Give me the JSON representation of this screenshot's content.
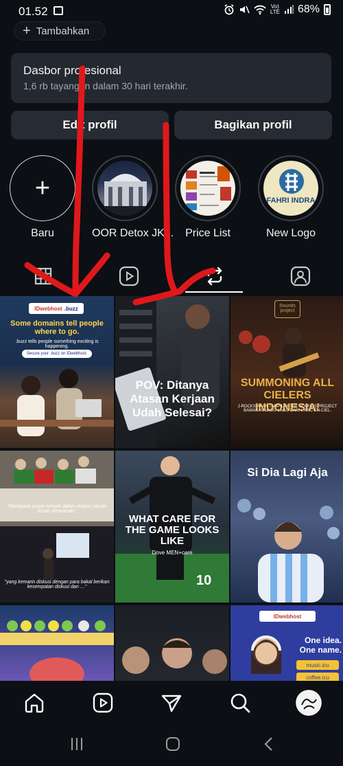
{
  "status": {
    "time": "01.52",
    "volte_top": "Vo)",
    "volte_bottom": "LTE",
    "battery": "68%"
  },
  "add_button": {
    "label": "Tambahkan"
  },
  "dashboard": {
    "title": "Dasbor profesional",
    "subtitle": "1,6 rb tayangan dalam 30 hari terakhir."
  },
  "buttons": {
    "edit": "Edit profil",
    "share": "Bagikan profil"
  },
  "highlights": [
    {
      "label": "Baru"
    },
    {
      "label": "OOR Detox JK..."
    },
    {
      "label": "Price List"
    },
    {
      "label": "New Logo",
      "art_text": "FAHRI INDRA"
    }
  ],
  "posts": [
    {
      "brand": "IDwebhost",
      "brand2": ".buzz",
      "headline": "Some domains tell people where to go.",
      "sub": ".buzz tells people something exciting is happening.",
      "cta": "Secure your .buzz on IDwebhost."
    },
    {
      "caption": "POV: Ditanya Atasan Kerjaan Udah Selesai?"
    },
    {
      "caption": "SUMMONING ALL CIELERS INDONESIA!",
      "sub": "J-ROCKS AKAN TAMPIL DI THE SOUNDS PROJECT BAWAKAN LAGU-LAGU DARI L'ARC-EN-CIEL.",
      "logo": "Sounds project"
    },
    {
      "quote1": "\"Membawa pesan terbaik dalam diskusi pikiran ilmiah demokratis\"",
      "quote2": "\"yang kemarin diskusi dengan para bakal berikan kesempatan diskusi dan …\""
    },
    {
      "caption": "WHAT CARE FOR THE GAME LOOKS LIKE",
      "brand": "Dove MEN+care",
      "number": "10"
    },
    {
      "caption": "Si Dia Lagi Aja"
    },
    {},
    {},
    {
      "brand": "IDwebhost",
      "headline": "One idea. One name.",
      "domain1": "music.icu",
      "domain2": "coffee.icu"
    }
  ],
  "icons": {
    "tab_grid": "grid-icon",
    "tab_reels": "reels-icon",
    "tab_reposts": "repost-icon",
    "tab_tagged": "tagged-icon"
  }
}
